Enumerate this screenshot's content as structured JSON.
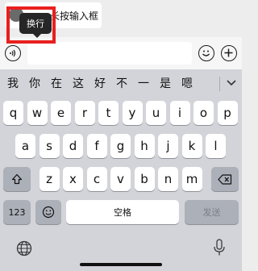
{
  "chat": {
    "bubble_text": "长按输入框"
  },
  "tooltip": {
    "label": "换行"
  },
  "keyboard": {
    "candidates": [
      "我",
      "你",
      "在",
      "这",
      "好",
      "不",
      "一",
      "是",
      "嗯"
    ],
    "row1": [
      "q",
      "w",
      "e",
      "r",
      "t",
      "y",
      "u",
      "i",
      "o",
      "p"
    ],
    "row2": [
      "a",
      "s",
      "d",
      "f",
      "g",
      "h",
      "j",
      "k",
      "l"
    ],
    "row3": [
      "z",
      "x",
      "c",
      "v",
      "b",
      "n",
      "m"
    ],
    "numbers_key": "123",
    "space_key": "空格",
    "send_key": "发送"
  },
  "colors": {
    "highlight": "#e8201e",
    "keyboard_bg": "#d2d4d9",
    "func_key": "#abb0b9"
  },
  "icons": [
    "voice-icon",
    "emoji-icon",
    "plus-icon",
    "chevron-down-icon",
    "shift-icon",
    "backspace-icon",
    "emoji-key-icon",
    "globe-icon",
    "microphone-icon"
  ]
}
